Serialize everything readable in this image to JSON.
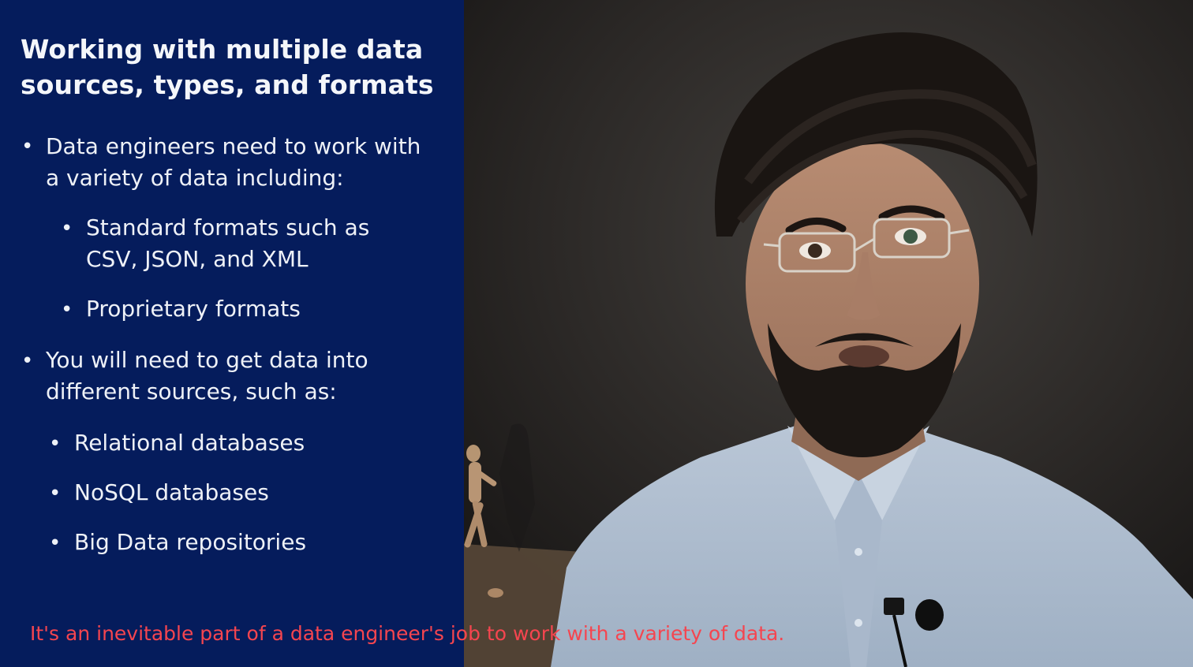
{
  "slide": {
    "title": "Working with multiple data\nsources, types, and formats",
    "bullet_1": "Data engineers need to work with\na variety of data including:",
    "bullet_1_sub_1": "Standard formats such as\nCSV, JSON, and XML",
    "bullet_1_sub_2": "Proprietary formats",
    "bullet_2": "You will need to get data into\ndifferent sources, such as:",
    "bullet_2_sub_1": "Relational databases",
    "bullet_2_sub_2": "NoSQL databases",
    "bullet_2_sub_3": "Big Data repositories",
    "bullet_symbol": "•",
    "background_color": "#051c5c"
  },
  "caption": {
    "text": "It's an inevitable part of a data engineer's job to work with a variety of data.",
    "color": "#f5454f"
  }
}
